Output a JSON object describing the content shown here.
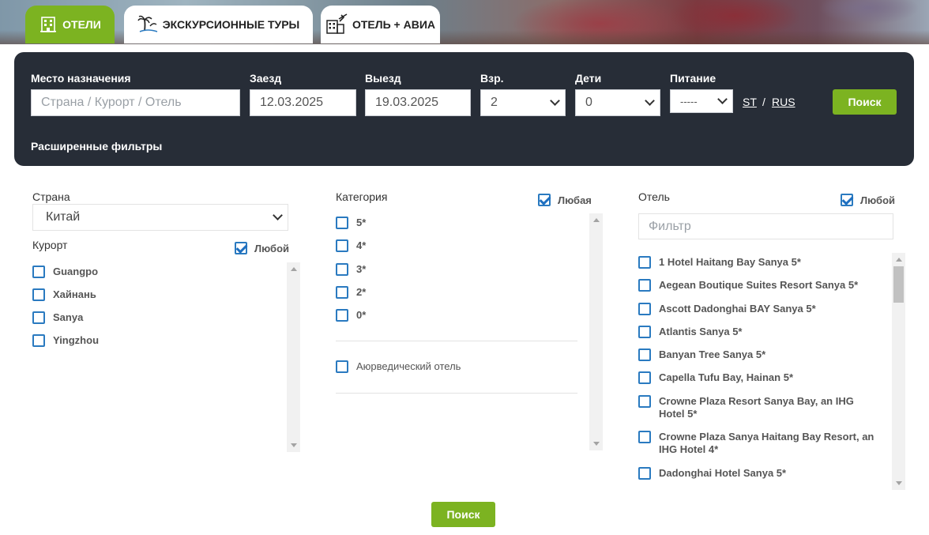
{
  "tabs": [
    {
      "label": "ОТЕЛИ",
      "icon": "hotel-icon",
      "active": true
    },
    {
      "label": "ЭКСКУРСИОННЫЕ ТУРЫ",
      "icon": "palm-tree-icon",
      "active": false
    },
    {
      "label": "ОТЕЛЬ +  АВИА",
      "icon": "building-plane-icon",
      "active": false
    }
  ],
  "search": {
    "destination_label": "Место назначения",
    "destination_placeholder": "Страна / Курорт / Отель",
    "checkin_label": "Заезд",
    "checkin_value": "12.03.2025",
    "checkout_label": "Выезд",
    "checkout_value": "19.03.2025",
    "adults_label": "Взр.",
    "adults_value": "2",
    "children_label": "Дети",
    "children_value": "0",
    "meal_label": "Питание",
    "meal_value": "-----",
    "lang_st": "ST",
    "lang_sep": "/",
    "lang_rus": "RUS",
    "search_button": "Поиск",
    "advanced_filters": "Расширенные фильтры"
  },
  "country": {
    "label": "Страна",
    "value": "Китай"
  },
  "resort": {
    "label": "Курорт",
    "any_label": "Любой",
    "items": [
      "Guangpo",
      "Хайнань",
      "Sanya",
      "Yingzhou"
    ]
  },
  "category": {
    "label": "Категория",
    "any_label": "Любая",
    "stars": [
      "5*",
      "4*",
      "3*",
      "2*",
      "0*"
    ],
    "extra": "Аюрведический отель"
  },
  "hotel": {
    "label": "Отель",
    "any_label": "Любой",
    "filter_placeholder": "Фильтр",
    "items": [
      "1 Hotel Haitang Bay Sanya 5*",
      "Aegean Boutique Suites Resort Sanya 5*",
      "Ascott Dadonghai BAY Sanya 5*",
      "Atlantis Sanya 5*",
      "Banyan Tree Sanya 5*",
      "Capella Tufu Bay, Hainan 5*",
      "Crowne Plaza Resort Sanya Bay, an IHG Hotel 5*",
      "Crowne Plaza Sanya Haitang Bay Resort, an IHG Hotel 4*",
      "Dadonghai Hotel Sanya 5*"
    ]
  },
  "bottom_search_button": "Поиск",
  "colors": {
    "accent": "#7cb321",
    "panel": "#272d37",
    "checkbox": "#2a7ac0"
  }
}
